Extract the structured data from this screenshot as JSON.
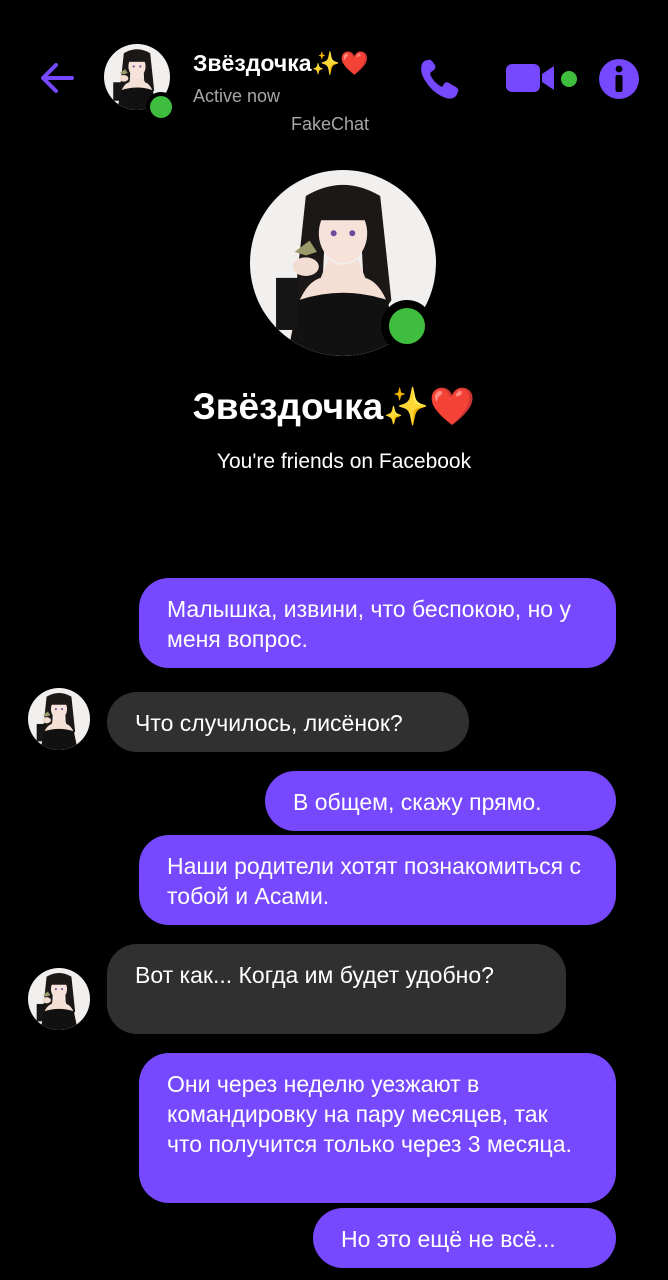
{
  "header": {
    "contact_name": "Звёздочка✨❤️",
    "status": "Active now",
    "watermark": "FakeChat",
    "back_icon": "back-arrow-icon",
    "call_icon": "phone-icon",
    "video_icon": "video-camera-icon",
    "info_icon": "info-icon"
  },
  "profile": {
    "name": "Звёздочка✨❤️",
    "subtitle": "You're friends on Facebook"
  },
  "messages": [
    {
      "from": "me",
      "text": "Малышка, извини, что беспокою, но у меня вопрос."
    },
    {
      "from": "them",
      "text": "Что случилось, лисёнок?"
    },
    {
      "from": "me",
      "text": "В общем, скажу прямо."
    },
    {
      "from": "me",
      "text": "Наши родители хотят познакомиться с тобой и Асами."
    },
    {
      "from": "them",
      "text": "Вот как... Когда им будет удобно?"
    },
    {
      "from": "me",
      "text": "Они через неделю уезжают в командировку на пару месяцев, так что получится только через 3 месяца."
    },
    {
      "from": "me",
      "text": "Но это ещё не всё..."
    }
  ],
  "colors": {
    "background": "#000000",
    "accent": "#7648fe",
    "incoming_bubble": "#303030",
    "online": "#3fbd3f",
    "muted_text": "#a6a6a6"
  }
}
